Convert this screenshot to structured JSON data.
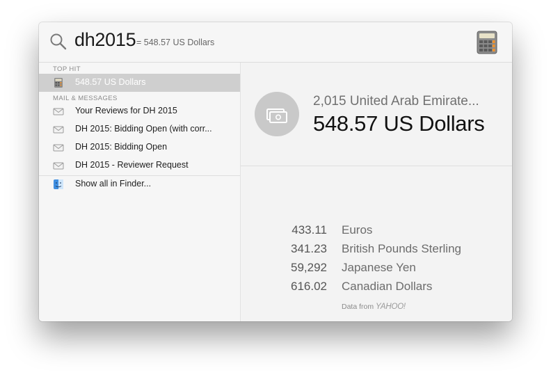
{
  "search": {
    "query": "dh2015",
    "inline_result": "= 548.57 US Dollars"
  },
  "icons": {
    "search": "search-icon",
    "calculator": "calculator-icon",
    "mail": "envelope-icon",
    "finder": "finder-icon",
    "currency": "banknotes-icon"
  },
  "sidebar": {
    "top_hit_header": "TOP HIT",
    "top_hit": {
      "label": "548.57 US Dollars"
    },
    "mail_header": "MAIL & MESSAGES",
    "mail_items": [
      {
        "label": "Your Reviews for DH 2015"
      },
      {
        "label": "DH 2015: Bidding Open (with corr..."
      },
      {
        "label": "DH 2015: Bidding Open"
      },
      {
        "label": "DH 2015 - Reviewer Request"
      }
    ],
    "show_all": "Show all in Finder..."
  },
  "preview": {
    "from": "2,015 United Arab Emirate...",
    "to": "548.57 US Dollars",
    "conversions": [
      {
        "amount": "433.11",
        "currency": "Euros"
      },
      {
        "amount": "341.23",
        "currency": "British Pounds Sterling"
      },
      {
        "amount": "59,292",
        "currency": "Japanese Yen"
      },
      {
        "amount": "616.02",
        "currency": "Canadian Dollars"
      }
    ],
    "data_from": "Data from",
    "provider": "YAHOO!"
  },
  "colors": {
    "selection": "#cfcfcf",
    "background": "#f6f6f6"
  }
}
